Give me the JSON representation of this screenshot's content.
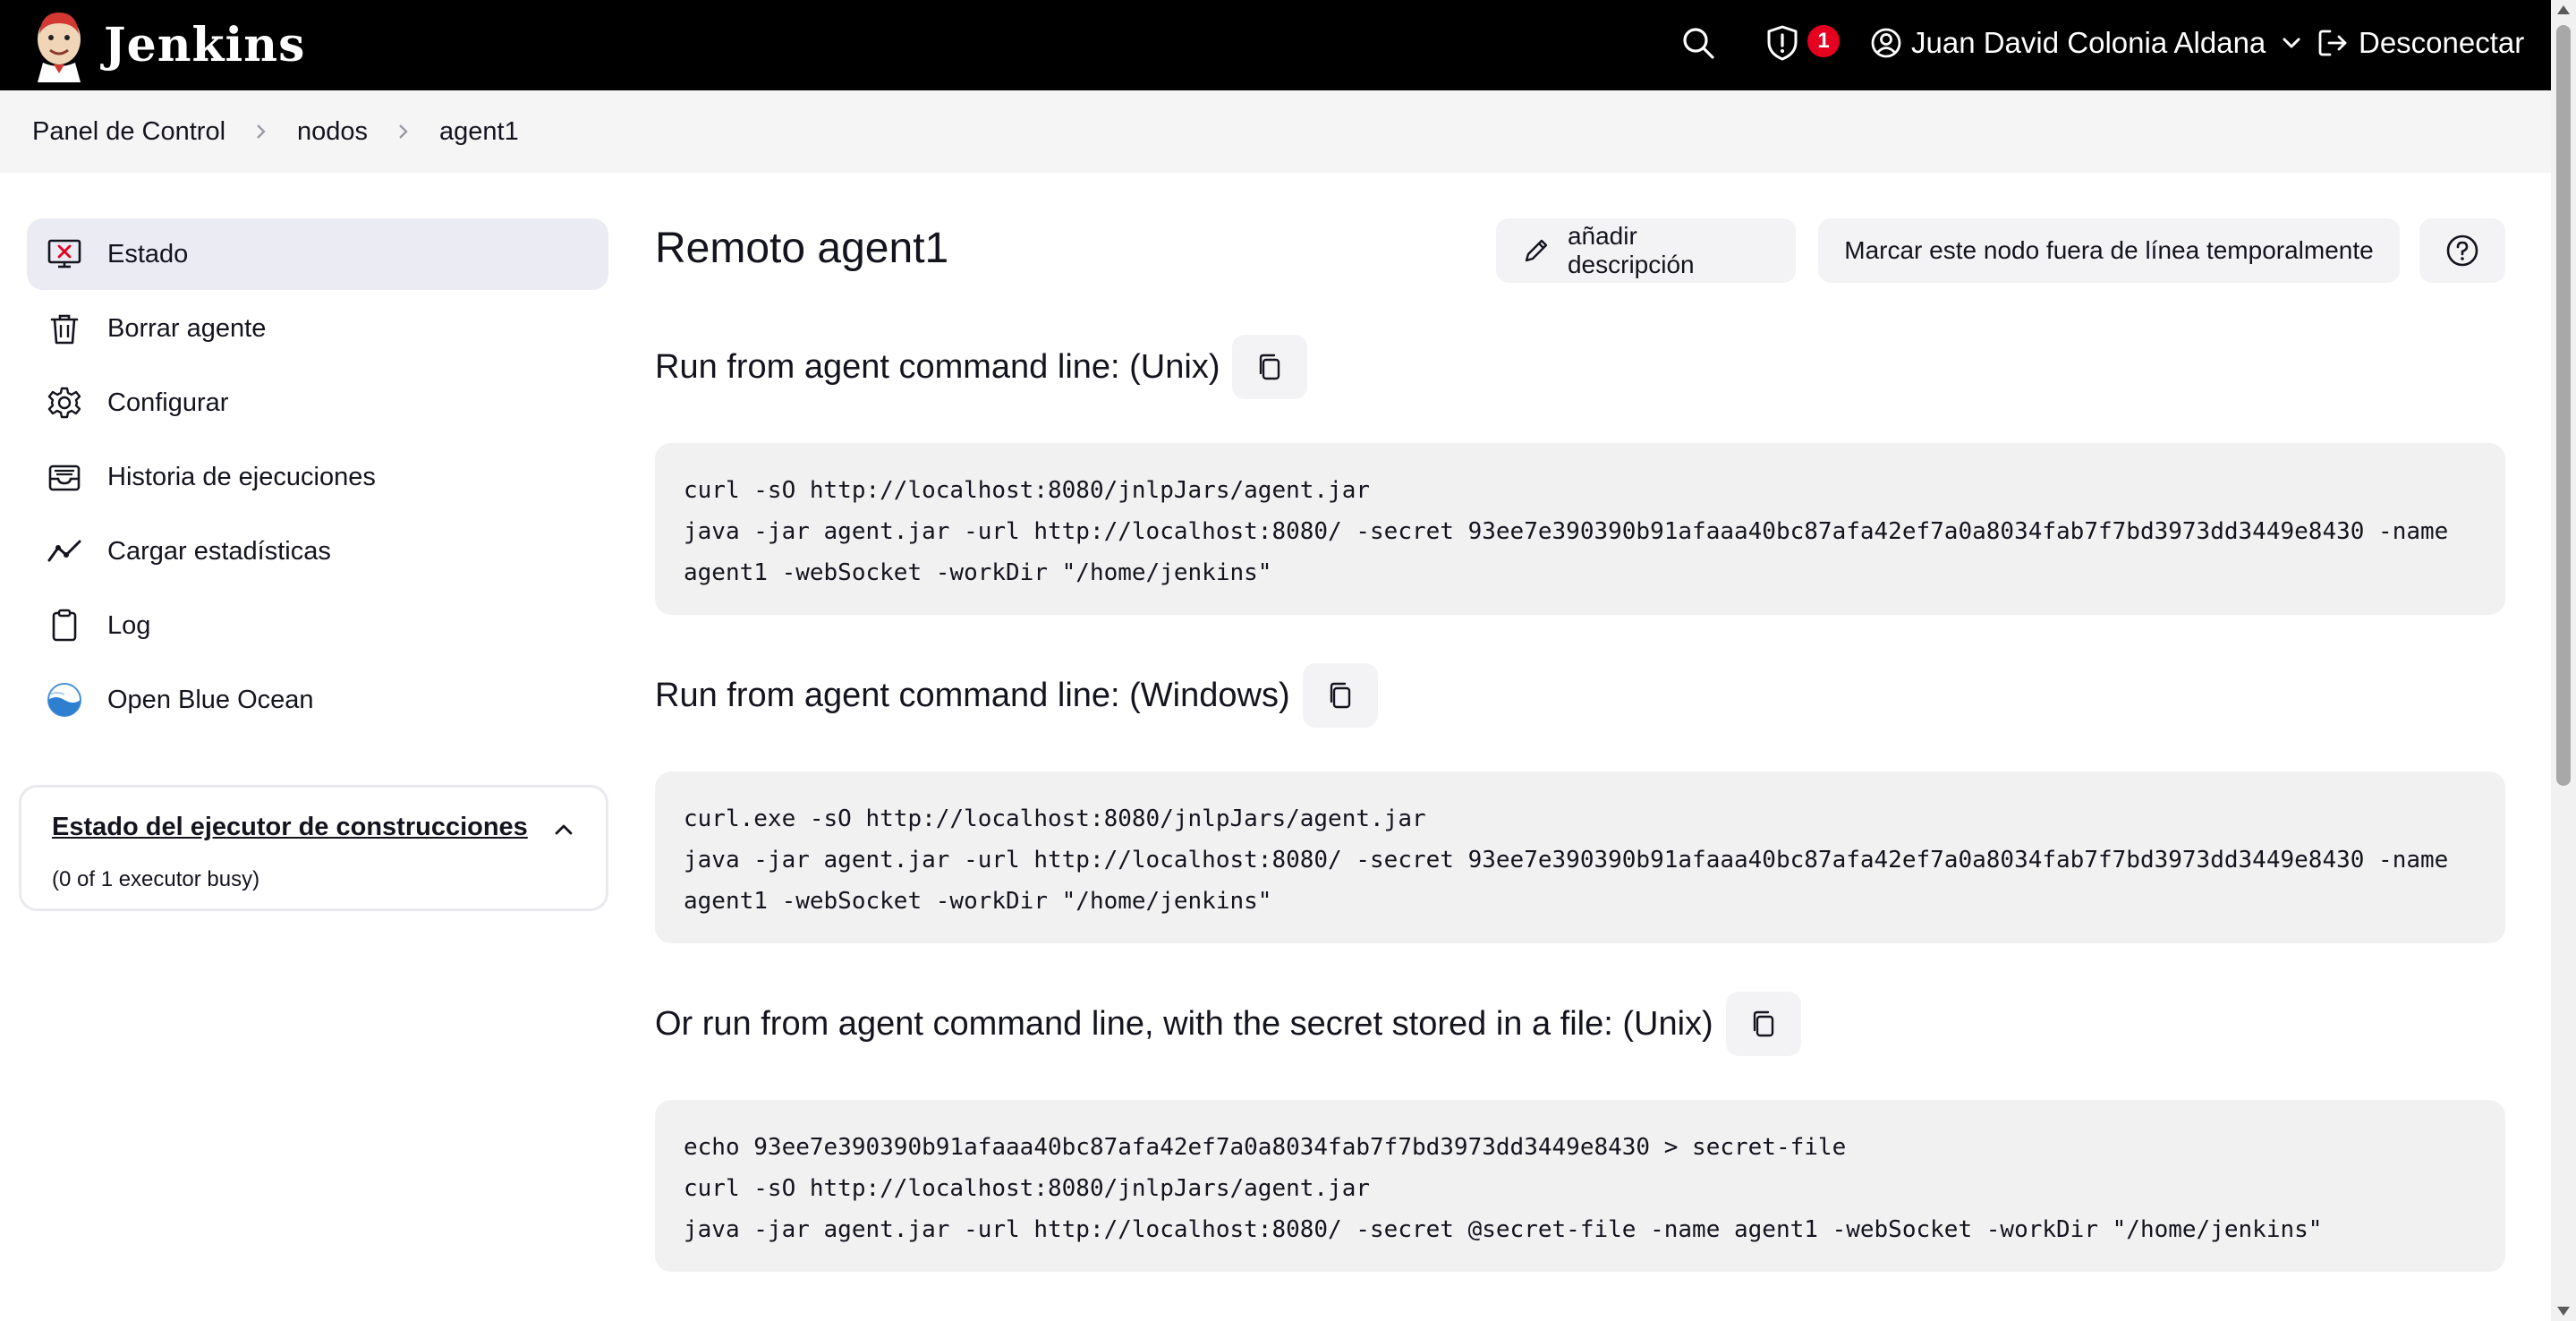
{
  "header": {
    "brand": "Jenkins",
    "alert_count": "1",
    "user_name": "Juan David Colonia Aldana",
    "logout_label": "Desconectar",
    "icons": [
      "jenkins-logo",
      "search-icon",
      "shield-alert-icon",
      "user-icon",
      "chevron-down-icon",
      "logout-icon"
    ]
  },
  "breadcrumb": {
    "items": [
      "Panel de Control",
      "nodos",
      "agent1"
    ]
  },
  "sidebar": {
    "items": [
      {
        "label": "Estado",
        "icon": "computer-error-icon",
        "active": true
      },
      {
        "label": "Borrar agente",
        "icon": "trash-icon"
      },
      {
        "label": "Configurar",
        "icon": "gear-icon"
      },
      {
        "label": "Historia de ejecuciones",
        "icon": "inbox-history-icon"
      },
      {
        "label": "Cargar estadísticas",
        "icon": "trend-chart-icon"
      },
      {
        "label": "Log",
        "icon": "clipboard-icon"
      },
      {
        "label": "Open Blue Ocean",
        "icon": "blue-ocean-icon"
      }
    ],
    "executor_panel": {
      "title": "Estado del ejecutor de construcciones",
      "status": "(0 of 1 executor busy)"
    }
  },
  "main": {
    "title": "Remoto agent1",
    "add_description_label": "añadir descripción",
    "offline_label": "Marcar este nodo fuera de línea temporalmente",
    "sections": [
      {
        "heading": "Run from agent command line: (Unix)",
        "lines": [
          "curl -sO http://localhost:8080/jnlpJars/agent.jar",
          "java -jar agent.jar -url http://localhost:8080/ -secret 93ee7e390390b91afaaa40bc87afa42ef7a0a8034fab7f7bd3973dd3449e8430 -name",
          "agent1 -webSocket -workDir \"/home/jenkins\""
        ]
      },
      {
        "heading": "Run from agent command line: (Windows)",
        "lines": [
          "curl.exe -sO http://localhost:8080/jnlpJars/agent.jar",
          "java -jar agent.jar -url http://localhost:8080/ -secret 93ee7e390390b91afaaa40bc87afa42ef7a0a8034fab7f7bd3973dd3449e8430 -name",
          "agent1 -webSocket -workDir \"/home/jenkins\""
        ]
      },
      {
        "heading": "Or run from agent command line, with the secret stored in a file: (Unix)",
        "lines": [
          "echo 93ee7e390390b91afaaa40bc87afa42ef7a0a8034fab7f7bd3973dd3449e8430 > secret-file",
          "curl -sO http://localhost:8080/jnlpJars/agent.jar",
          "java -jar agent.jar -url http://localhost:8080/ -secret @secret-file -name agent1 -webSocket -workDir \"/home/jenkins\""
        ]
      }
    ]
  }
}
